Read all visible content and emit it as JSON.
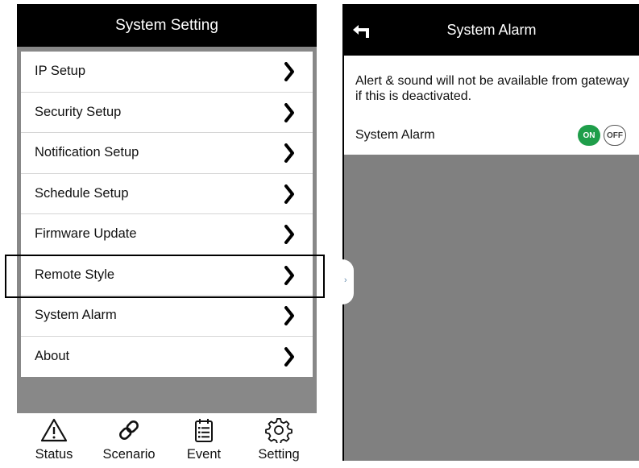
{
  "left": {
    "title": "System Setting",
    "menu_items": [
      {
        "label": "IP Setup"
      },
      {
        "label": "Security Setup"
      },
      {
        "label": "Notification Setup"
      },
      {
        "label": "Schedule Setup"
      },
      {
        "label": "Firmware Update"
      },
      {
        "label": "Remote Style"
      },
      {
        "label": "System Alarm"
      },
      {
        "label": "About"
      }
    ],
    "highlighted_item": "Remote Style",
    "tabs": [
      {
        "label": "Status",
        "icon": "warning-icon"
      },
      {
        "label": "Scenario",
        "icon": "link-icon"
      },
      {
        "label": "Event",
        "icon": "calendar-list-icon"
      },
      {
        "label": "Setting",
        "icon": "gear-icon"
      }
    ]
  },
  "right": {
    "title": "System Alarm",
    "description": "Alert & sound will not be available from gateway if this is deactivated.",
    "toggle_label": "System Alarm",
    "on_label": "ON",
    "off_label": "OFF",
    "toggle_state": "ON"
  },
  "colors": {
    "header_bg": "#000000",
    "panel_bg": "#888888",
    "on_green": "#1f9e4a"
  }
}
